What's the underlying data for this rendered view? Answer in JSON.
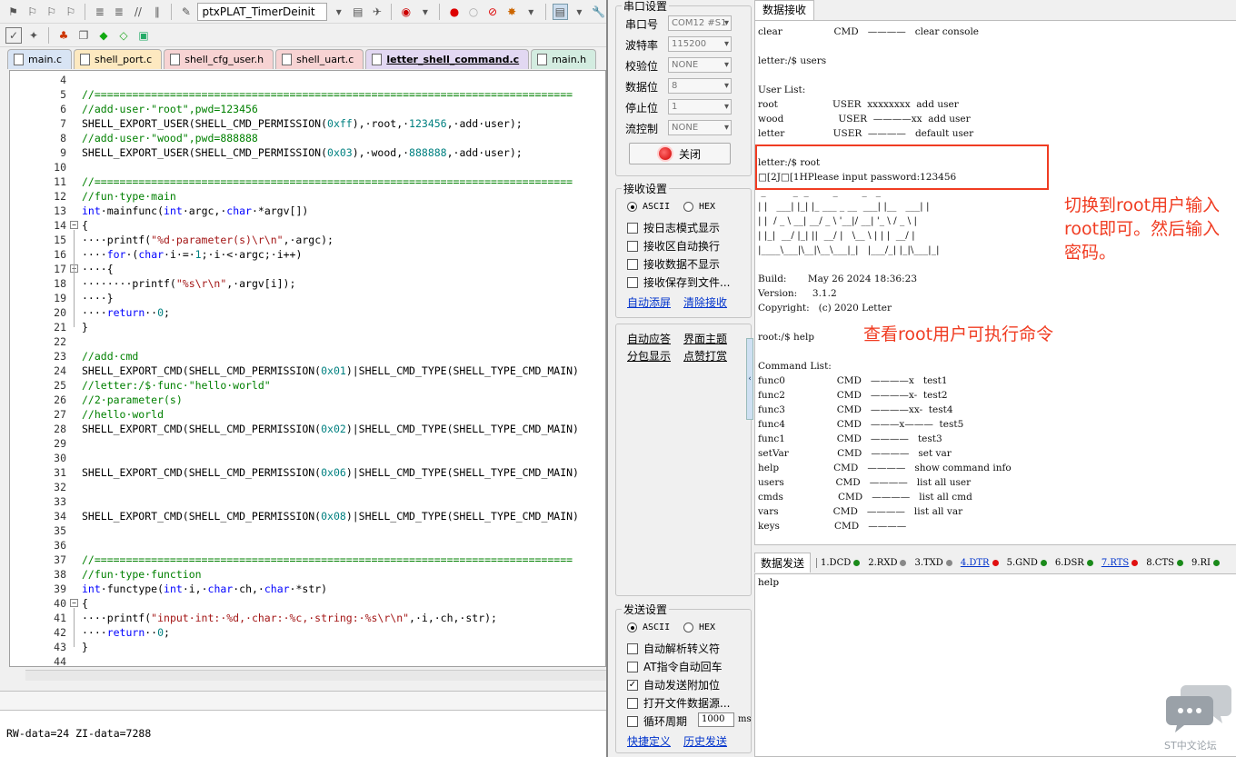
{
  "toolbar": {
    "target_combo": "ptxPLAT_TimerDeinit"
  },
  "tabs": [
    "main.c",
    "shell_port.c",
    "shell_cfg_user.h",
    "shell_uart.c",
    "letter_shell_command.c",
    "main.h"
  ],
  "code": {
    "lines": [
      {
        "n": "4",
        "t": []
      },
      {
        "n": "5",
        "t": [
          [
            "cm",
            "//============================================================================"
          ]
        ]
      },
      {
        "n": "6",
        "t": [
          [
            "cm",
            "//add·user·\"root\",pwd=123456"
          ]
        ]
      },
      {
        "n": "7",
        "t": [
          [
            "",
            "SHELL_EXPORT_USER(SHELL_CMD_PERMISSION("
          ],
          [
            "num",
            "0xff"
          ],
          [
            "",
            "),·root,·"
          ],
          [
            "num",
            "123456"
          ],
          [
            "",
            ",·add·user);"
          ]
        ]
      },
      {
        "n": "8",
        "t": [
          [
            "cm",
            "//add·user·\"wood\",pwd=888888"
          ]
        ]
      },
      {
        "n": "9",
        "t": [
          [
            "",
            "SHELL_EXPORT_USER(SHELL_CMD_PERMISSION("
          ],
          [
            "num",
            "0x03"
          ],
          [
            "",
            "),·wood,·"
          ],
          [
            "num",
            "888888"
          ],
          [
            "",
            ",·add·user);"
          ]
        ]
      },
      {
        "n": "10",
        "t": []
      },
      {
        "n": "11",
        "t": [
          [
            "cm",
            "//============================================================================"
          ]
        ]
      },
      {
        "n": "12",
        "t": [
          [
            "cm",
            "//fun·type·main"
          ]
        ]
      },
      {
        "n": "13",
        "t": [
          [
            "kw",
            "int"
          ],
          [
            "",
            "·mainfunc("
          ],
          [
            "kw",
            "int"
          ],
          [
            "",
            "·argc,·"
          ],
          [
            "kw",
            "char"
          ],
          [
            "",
            "·*argv[])"
          ]
        ]
      },
      {
        "n": "14",
        "t": [
          [
            "",
            "{"
          ]
        ]
      },
      {
        "n": "15",
        "t": [
          [
            "",
            "····printf("
          ],
          [
            "str",
            "\"%d·parameter(s)\\r\\n\""
          ],
          [
            "",
            ",·argc);"
          ]
        ]
      },
      {
        "n": "16",
        "t": [
          [
            "",
            "····"
          ],
          [
            "kw",
            "for"
          ],
          [
            "",
            "·("
          ],
          [
            "kw",
            "char"
          ],
          [
            "",
            "·i·=·"
          ],
          [
            "num",
            "1"
          ],
          [
            "",
            ";·i·<·argc;·i++)"
          ]
        ]
      },
      {
        "n": "17",
        "t": [
          [
            "",
            "····{"
          ]
        ]
      },
      {
        "n": "18",
        "t": [
          [
            "",
            "········printf("
          ],
          [
            "str",
            "\"%s\\r\\n\""
          ],
          [
            "",
            ",·argv[i]);"
          ]
        ]
      },
      {
        "n": "19",
        "t": [
          [
            "",
            "····}"
          ]
        ]
      },
      {
        "n": "20",
        "t": [
          [
            "",
            "····"
          ],
          [
            "kw",
            "return"
          ],
          [
            "",
            "··"
          ],
          [
            "num",
            "0"
          ],
          [
            "",
            ";"
          ]
        ]
      },
      {
        "n": "21",
        "t": [
          [
            "",
            "}"
          ]
        ]
      },
      {
        "n": "22",
        "t": []
      },
      {
        "n": "23",
        "t": [
          [
            "cm",
            "//add·cmd"
          ]
        ]
      },
      {
        "n": "24",
        "t": [
          [
            "",
            "SHELL_EXPORT_CMD(SHELL_CMD_PERMISSION("
          ],
          [
            "num",
            "0x01"
          ],
          [
            "",
            ")|SHELL_CMD_TYPE(SHELL_TYPE_CMD_MAIN)"
          ]
        ]
      },
      {
        "n": "25",
        "t": [
          [
            "cm",
            "//letter:/$·func·\"hello·world\""
          ]
        ]
      },
      {
        "n": "26",
        "t": [
          [
            "cm",
            "//2·parameter(s)"
          ]
        ]
      },
      {
        "n": "27",
        "t": [
          [
            "cm",
            "//hello·world"
          ]
        ]
      },
      {
        "n": "28",
        "t": [
          [
            "",
            "SHELL_EXPORT_CMD(SHELL_CMD_PERMISSION("
          ],
          [
            "num",
            "0x02"
          ],
          [
            "",
            ")|SHELL_CMD_TYPE(SHELL_TYPE_CMD_MAIN)"
          ]
        ]
      },
      {
        "n": "29",
        "t": []
      },
      {
        "n": "30",
        "t": []
      },
      {
        "n": "31",
        "t": [
          [
            "",
            "SHELL_EXPORT_CMD(SHELL_CMD_PERMISSION("
          ],
          [
            "num",
            "0x06"
          ],
          [
            "",
            ")|SHELL_CMD_TYPE(SHELL_TYPE_CMD_MAIN)"
          ]
        ]
      },
      {
        "n": "32",
        "t": []
      },
      {
        "n": "33",
        "t": []
      },
      {
        "n": "34",
        "t": [
          [
            "",
            "SHELL_EXPORT_CMD(SHELL_CMD_PERMISSION("
          ],
          [
            "num",
            "0x08"
          ],
          [
            "",
            ")|SHELL_CMD_TYPE(SHELL_TYPE_CMD_MAIN)"
          ]
        ]
      },
      {
        "n": "35",
        "t": []
      },
      {
        "n": "36",
        "t": []
      },
      {
        "n": "37",
        "t": [
          [
            "cm",
            "//============================================================================"
          ]
        ]
      },
      {
        "n": "38",
        "t": [
          [
            "cm",
            "//fun·type·function"
          ]
        ]
      },
      {
        "n": "39",
        "t": [
          [
            "kw",
            "int"
          ],
          [
            "",
            "·functype("
          ],
          [
            "kw",
            "int"
          ],
          [
            "",
            "·i,·"
          ],
          [
            "kw",
            "char"
          ],
          [
            "",
            "·ch,·"
          ],
          [
            "kw",
            "char"
          ],
          [
            "",
            "·*str)"
          ]
        ]
      },
      {
        "n": "40",
        "t": [
          [
            "",
            "{"
          ]
        ]
      },
      {
        "n": "41",
        "t": [
          [
            "",
            "····printf("
          ],
          [
            "str",
            "\"input·int:·%d,·char:·%c,·string:·%s\\r\\n\""
          ],
          [
            "",
            ",·i,·ch,·str);"
          ]
        ]
      },
      {
        "n": "42",
        "t": [
          [
            "",
            "····"
          ],
          [
            "kw",
            "return"
          ],
          [
            "",
            "··"
          ],
          [
            "num",
            "0"
          ],
          [
            "",
            ";"
          ]
        ]
      },
      {
        "n": "43",
        "t": [
          [
            "",
            "}"
          ]
        ]
      },
      {
        "n": "44",
        "t": []
      }
    ]
  },
  "build_output": "RW-data=24 ZI-data=7288",
  "serial": {
    "port_group": "串口设置",
    "fields": [
      {
        "label": "串口号",
        "value": "COM12 #S1"
      },
      {
        "label": "波特率",
        "value": "115200"
      },
      {
        "label": "校验位",
        "value": "NONE"
      },
      {
        "label": "数据位",
        "value": "8"
      },
      {
        "label": "停止位",
        "value": "1"
      },
      {
        "label": "流控制",
        "value": "NONE"
      }
    ],
    "close_button": "关闭",
    "rx_group": "接收设置",
    "ascii": "ASCII",
    "hex": "HEX",
    "rx_options": [
      "按日志模式显示",
      "接收区自动换行",
      "接收数据不显示",
      "接收保存到文件..."
    ],
    "auto_clear": "自动添屏",
    "clear_rx": "清除接收",
    "auto_reply": "自动应答",
    "theme": "界面主题",
    "split_display": "分包显示",
    "donate": "点赞打赏",
    "tx_group": "发送设置",
    "tx_options": [
      {
        "label": "自动解析转义符",
        "checked": false
      },
      {
        "label": "AT指令自动回车",
        "checked": false
      },
      {
        "label": "自动发送附加位",
        "checked": true
      },
      {
        "label": "打开文件数据源...",
        "checked": false
      }
    ],
    "cycle_label": "循环周期",
    "cycle_value": "1000",
    "cycle_unit": "ms",
    "shortcut": "快捷定义",
    "history": "历史发送",
    "rx_tab": "数据接收",
    "tx_tab": "数据发送",
    "tx_text": "help",
    "signals": [
      {
        "label": "1.DCD",
        "color": "#1a8a1a",
        "underline": false
      },
      {
        "label": "2.RXD",
        "color": "#888888",
        "underline": false
      },
      {
        "label": "3.TXD",
        "color": "#888888",
        "underline": false
      },
      {
        "label": "4.DTR",
        "color": "#e01010",
        "underline": true
      },
      {
        "label": "5.GND",
        "color": "#1a8a1a",
        "underline": false
      },
      {
        "label": "6.DSR",
        "color": "#1a8a1a",
        "underline": false
      },
      {
        "label": "7.RTS",
        "color": "#e01010",
        "underline": true
      },
      {
        "label": "8.CTS",
        "color": "#1a8a1a",
        "underline": false
      },
      {
        "label": "9.RI",
        "color": "#1a8a1a",
        "underline": false
      }
    ],
    "rx_lines": [
      "clear                 CMD   ————   clear console",
      "",
      "letter:/$ users",
      "",
      "User List:",
      "root                  USER  xxxxxxxx  add user",
      "wood                  USER  ————xx  add user",
      "letter                USER  ————   default user",
      "",
      "letter:/$ root",
      "□[2J□[1HPlease input password:123456",
      " _         _  _        _        _   _ ",
      "| |   ___| |_| |_ ___ _ __  ___| |__   ___| |",
      "| |  / _ \\ __| __/ _ \\ '__|/ __| '_ \\ / _ \\ |",
      "| |_|  __/ |_| ||  __/ |   \\__ \\ | | |  __/ |",
      "|____\\___|\\__|\\__\\___|_|   |___/_| |_|\\___|_|",
      "",
      "Build:       May 26 2024 18:36:23",
      "Version:     3.1.2",
      "Copyright:   (c) 2020 Letter",
      "",
      "root:/$ help",
      "",
      "Command List:",
      "func0                 CMD   ————x   test1",
      "func2                 CMD   ————x-  test2",
      "func3                 CMD   ————xx-  test4",
      "func4                 CMD   ———x———  test5",
      "func1                 CMD   ————   test3",
      "setVar                CMD   ————   set var",
      "help                  CMD   ————   show command info",
      "users                 CMD   ————   list all user",
      "cmds                  CMD   ————   list all cmd",
      "vars                  CMD   ————   list all var",
      "keys                  CMD   ————"
    ]
  },
  "annotations": {
    "note1": "切换到root用户输入root即可。然后输入密码。",
    "note2": "查看root用户可执行命令"
  },
  "watermark": "ST中文论坛",
  "colors": {
    "highlight_box": "#f03c22",
    "annotation": "#f03c22"
  }
}
